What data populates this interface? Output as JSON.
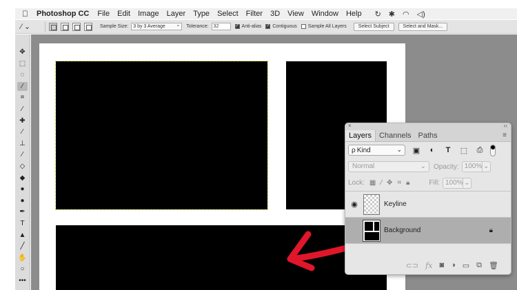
{
  "menubar": {
    "apple": "",
    "app_name": "Photoshop CC",
    "items": [
      "File",
      "Edit",
      "Image",
      "Layer",
      "Type",
      "Select",
      "Filter",
      "3D",
      "View",
      "Window",
      "Help"
    ],
    "tray": [
      "↻",
      "✱",
      "◠",
      "◁)"
    ]
  },
  "options_bar": {
    "tool_glyph": "⁄ ⌄",
    "sample_size_label": "Sample Size:",
    "sample_size_value": "3 by 3 Average",
    "tolerance_label": "Tolerance:",
    "tolerance_value": "32",
    "anti_alias_label": "Anti-alias",
    "anti_alias_checked": true,
    "contiguous_label": "Contiguous",
    "contiguous_checked": true,
    "sample_all_label": "Sample All Layers",
    "sample_all_checked": false,
    "select_subject_label": "Select Subject",
    "select_mask_label": "Select and Mask..."
  },
  "tools": [
    {
      "name": "move-tool",
      "glyph": "✥"
    },
    {
      "name": "marquee-tool",
      "glyph": "⬚"
    },
    {
      "name": "lasso-tool",
      "glyph": "◌"
    },
    {
      "name": "magic-wand-tool",
      "glyph": "⁄",
      "active": true
    },
    {
      "name": "crop-tool",
      "glyph": "⌗"
    },
    {
      "name": "eyedropper-tool",
      "glyph": "⁄"
    },
    {
      "name": "healing-tool",
      "glyph": "✚"
    },
    {
      "name": "brush-tool",
      "glyph": "⁄"
    },
    {
      "name": "stamp-tool",
      "glyph": "⊥"
    },
    {
      "name": "history-brush-tool",
      "glyph": "⁄"
    },
    {
      "name": "eraser-tool",
      "glyph": "◇"
    },
    {
      "name": "paint-bucket-tool",
      "glyph": "◆"
    },
    {
      "name": "smudge-tool",
      "glyph": "●"
    },
    {
      "name": "dodge-tool",
      "glyph": "●"
    },
    {
      "name": "pen-tool",
      "glyph": "✒"
    },
    {
      "name": "type-tool",
      "glyph": "T"
    },
    {
      "name": "path-select-tool",
      "glyph": "▲"
    },
    {
      "name": "line-tool",
      "glyph": "╱"
    },
    {
      "name": "hand-tool",
      "glyph": "✋"
    },
    {
      "name": "zoom-tool",
      "glyph": "○"
    },
    {
      "name": "more-tools",
      "glyph": "•••"
    }
  ],
  "layers_panel": {
    "close_glyph": "×",
    "collapse_glyph": "‹‹",
    "tabs": [
      "Layers",
      "Channels",
      "Paths"
    ],
    "menu_glyph": "≡",
    "filter_kind": "Kind",
    "filter_search_glyph": "ρ",
    "filter_icons": [
      {
        "name": "image-filter-icon",
        "glyph": "▣"
      },
      {
        "name": "adjustment-filter-icon",
        "glyph": "◐"
      },
      {
        "name": "type-filter-icon",
        "glyph": "T"
      },
      {
        "name": "shape-filter-icon",
        "glyph": "⬚"
      },
      {
        "name": "smart-object-filter-icon",
        "glyph": "⎙"
      }
    ],
    "blend_mode": "Normal",
    "opacity_label": "Opacity:",
    "opacity_value": "100%",
    "lock_label": "Lock:",
    "fill_label": "Fill:",
    "fill_value": "100%",
    "layers": [
      {
        "name": "Keyline",
        "visible": true,
        "selected": false,
        "locked": false
      },
      {
        "name": "Background",
        "visible": true,
        "selected": true,
        "locked": true
      }
    ]
  },
  "colors": {
    "annotation_arrow": "#e0162b",
    "selection_marquee": "#e8e85a"
  }
}
